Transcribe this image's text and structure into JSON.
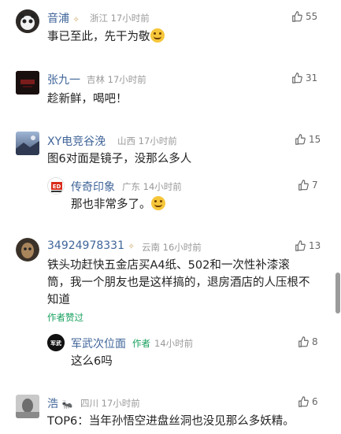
{
  "comments": [
    {
      "name": "音浦",
      "badge": "vip-icon",
      "location": "浙江",
      "time": "17小时前",
      "likes": "55",
      "text": "事已至此，先干为敬",
      "emoji": "thinking-emoji-icon"
    },
    {
      "name": "张九一",
      "location": "吉林",
      "time": "17小时前",
      "likes": "31",
      "text": "趁新鲜，喝吧！"
    },
    {
      "name": "XY电竞谷浼",
      "location": "山西",
      "time": "17小时前",
      "likes": "15",
      "text": "图6对面是镜子，没那么多人",
      "reply": {
        "name": "传奇印象",
        "location": "广东",
        "time": "14小时前",
        "likes": "7",
        "text": "那也非常多了。",
        "emoji": "grin-emoji-icon"
      }
    },
    {
      "name": "34924978331",
      "badge": "vip-icon",
      "location": "云南",
      "time": "16小时前",
      "likes": "13",
      "text": "铁头功赶快五金店买A4纸、502和一次性补漆滚筒，我一个朋友也是这样搞的，退房酒店的人压根不知道",
      "author_liked": "作者赞过",
      "reply": {
        "name": "军武次位面",
        "author_tag": "作者",
        "time": "14小时前",
        "likes": "8",
        "text": "这么6吗"
      }
    },
    {
      "name": "浩",
      "badge": "ant-icon",
      "location": "四川",
      "time": "17小时前",
      "likes": "6",
      "text": "TOP6：当年孙悟空进盘丝洞也没见那么多妖精。"
    }
  ]
}
